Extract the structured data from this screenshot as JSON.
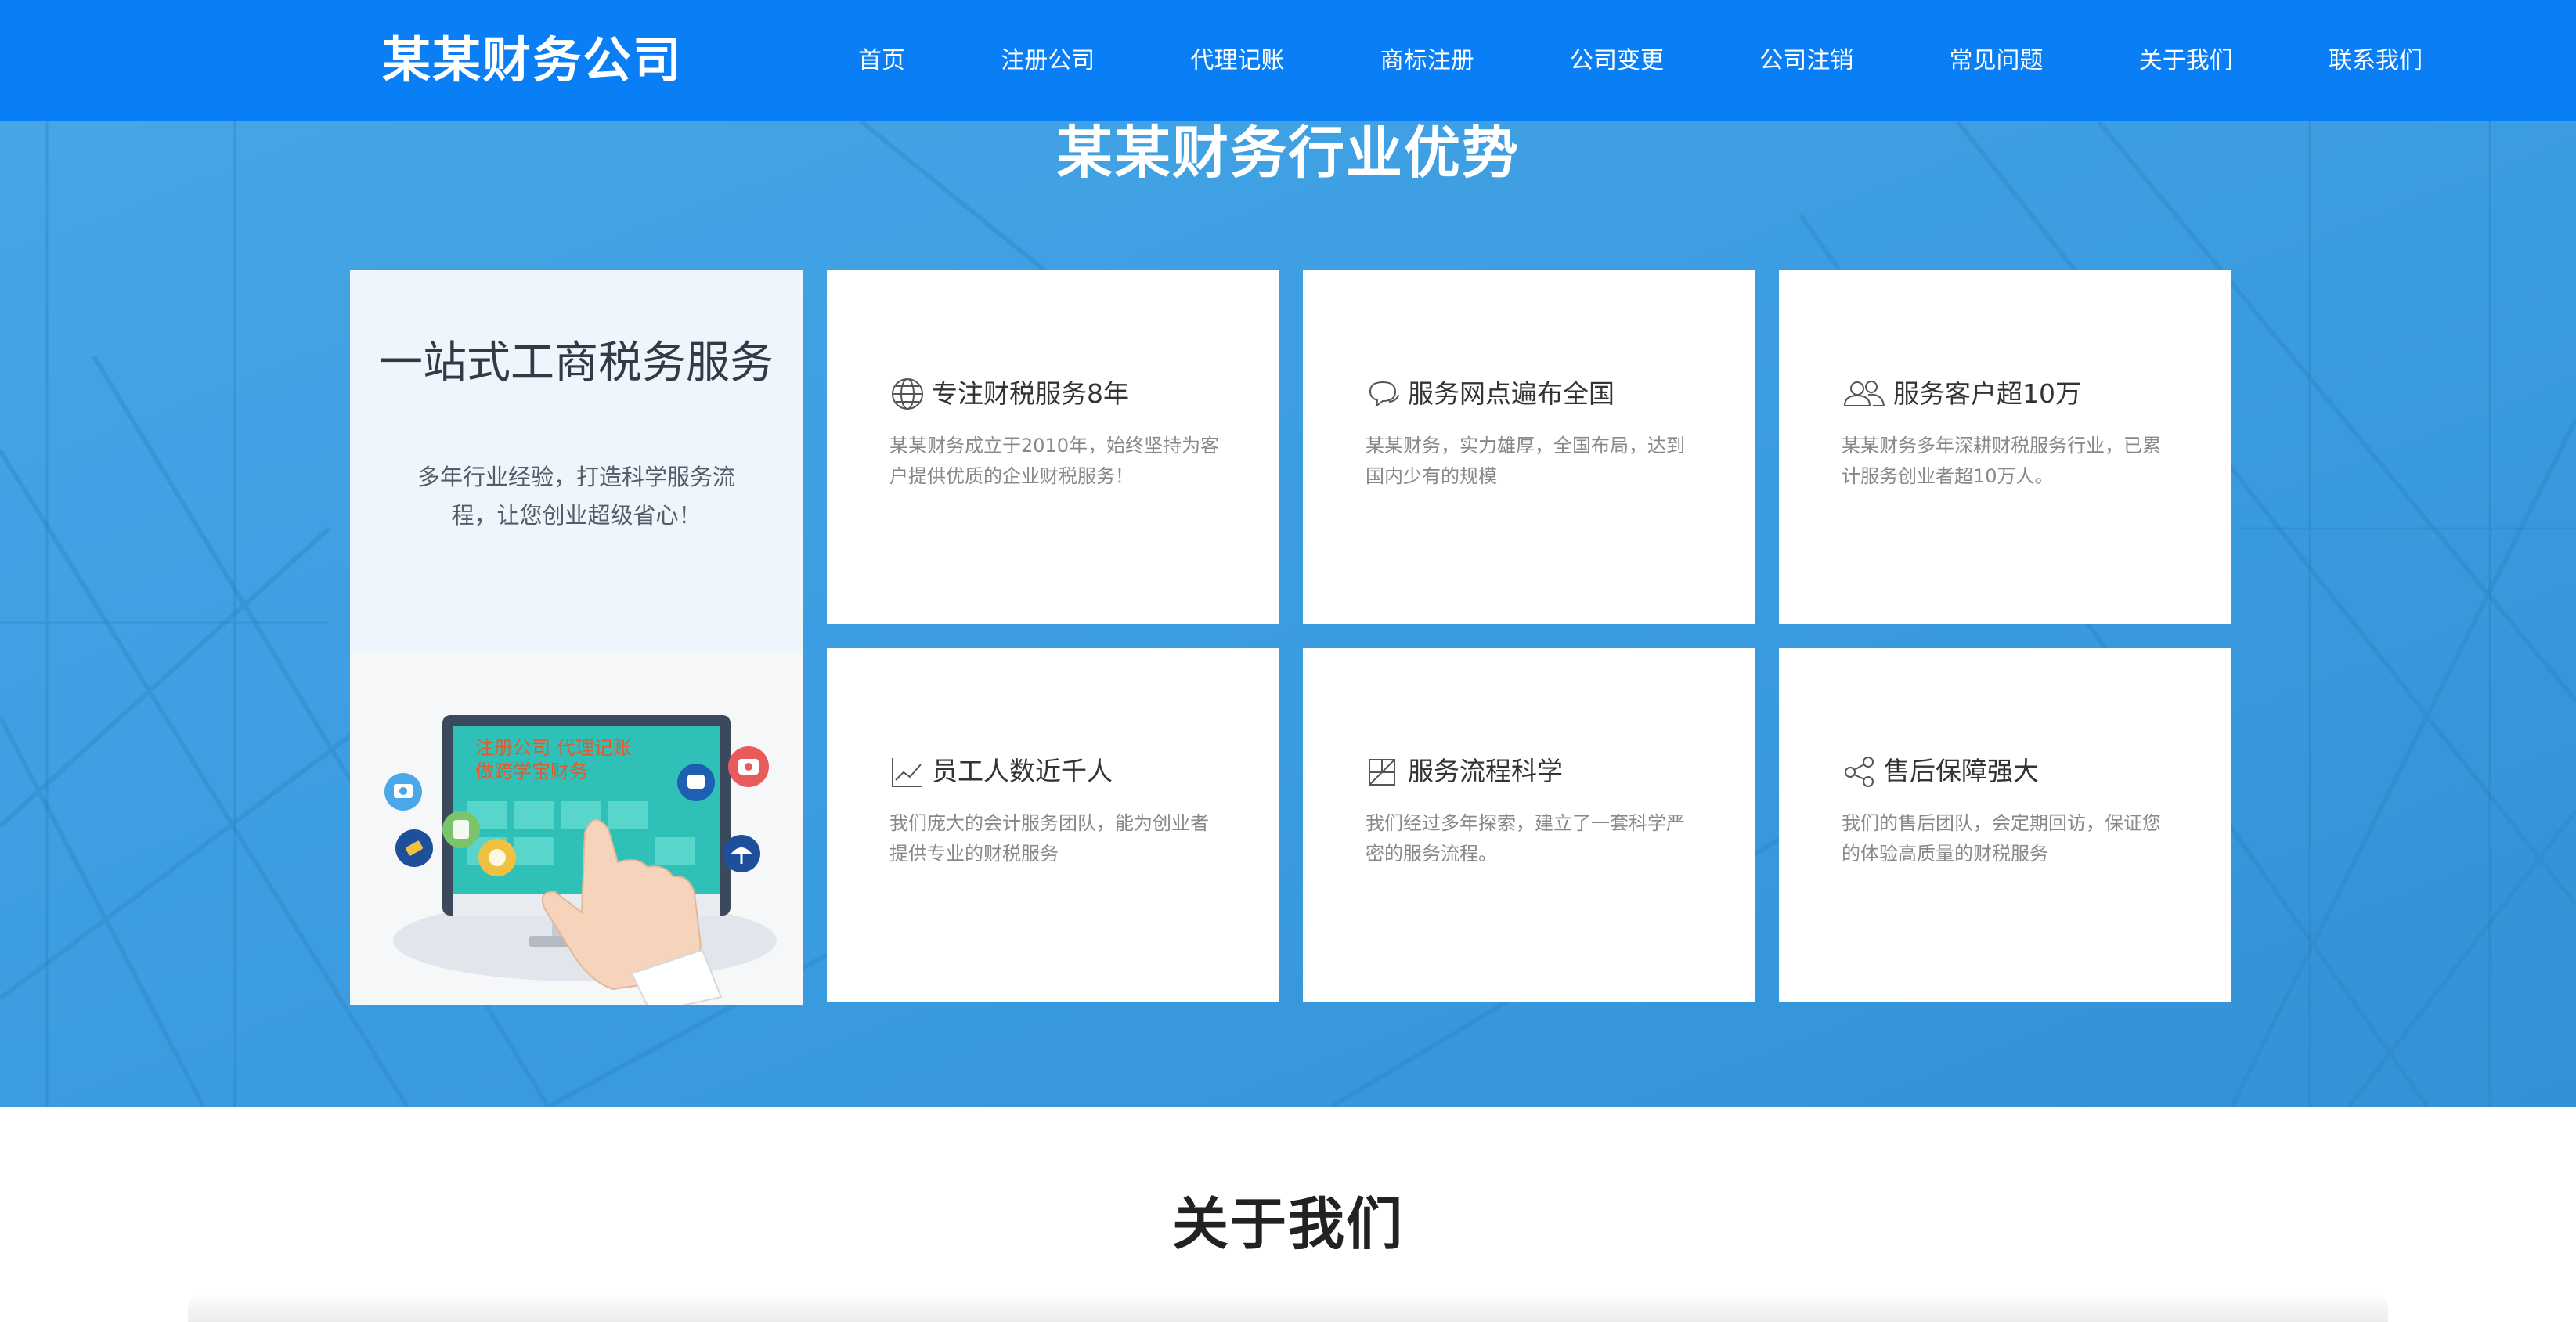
{
  "header": {
    "logo": "某某财务公司",
    "nav": [
      "首页",
      "注册公司",
      "代理记账",
      "商标注册",
      "公司变更",
      "公司注销",
      "常见问题",
      "关于我们",
      "联系我们"
    ]
  },
  "advantages": {
    "title": "某某财务行业优势",
    "intro_heading": "一站式工商税务服务",
    "intro_desc": "多年行业经验，打造科学服务流程，让您创业超级省心！",
    "illustration_text_line1": "注册公司 代理记账",
    "illustration_text_line2": "做跨学宝财务",
    "cards": [
      {
        "icon": "globe-icon",
        "title": "专注财税服务8年",
        "desc": "某某财务成立于2010年，始终坚持为客户提供优质的企业财税服务！"
      },
      {
        "icon": "chat-icon",
        "title": "服务网点遍布全国",
        "desc": "某某财务，实力雄厚，全国布局，达到国内少有的规模"
      },
      {
        "icon": "users-icon",
        "title": "服务客户超10万",
        "desc": "某某财务多年深耕财税服务行业，已累计服务创业者超10万人。"
      },
      {
        "icon": "trend-chart-icon",
        "title": "员工人数近千人",
        "desc": "我们庞大的会计服务团队，能为创业者提供专业的财税服务"
      },
      {
        "icon": "process-icon",
        "title": "服务流程科学",
        "desc": "我们经过多年探索，建立了一套科学严密的服务流程。"
      },
      {
        "icon": "share-icon",
        "title": "售后保障强大",
        "desc": "我们的售后团队，会定期回访，保证您的体验高质量的财税服务"
      }
    ]
  },
  "about": {
    "title": "关于我们"
  },
  "colors": {
    "header_bg": "#0a7ff5",
    "hero_bg": "#3a9ce0",
    "card_bg": "#ffffff",
    "intro_bg": "#eef5fd"
  }
}
